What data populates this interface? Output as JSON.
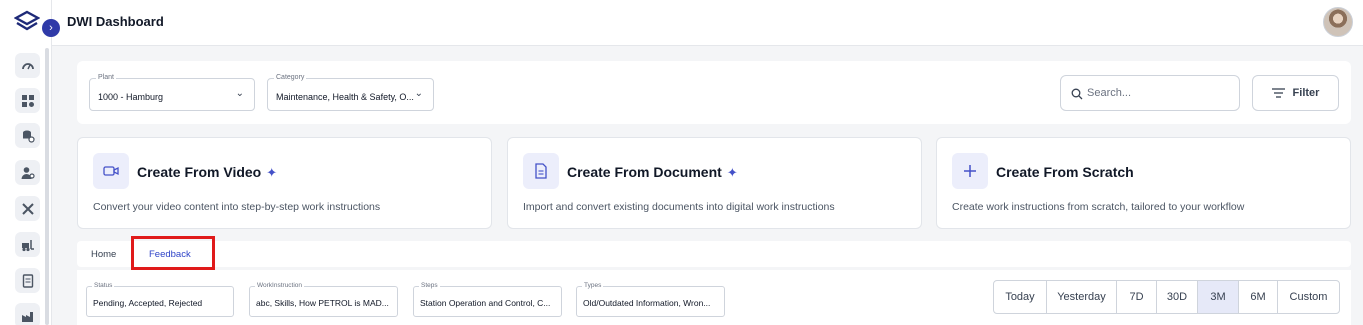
{
  "app": {
    "title": "DWI Dashboard"
  },
  "sidebar": {
    "expand_glyph": "›",
    "items": [
      {
        "icon": "gauge-icon"
      },
      {
        "icon": "apps-grid-icon"
      },
      {
        "icon": "database-settings-icon"
      },
      {
        "icon": "user-settings-icon"
      },
      {
        "icon": "tools-icon"
      },
      {
        "icon": "forklift-icon"
      },
      {
        "icon": "document-icon"
      },
      {
        "icon": "factory-icon"
      }
    ]
  },
  "filters": {
    "plant": {
      "label": "Plant",
      "value": "1000 - Hamburg"
    },
    "category": {
      "label": "Category",
      "value": "Maintenance, Health & Safety, O..."
    },
    "search_placeholder": "Search...",
    "filter_label": "Filter"
  },
  "create_cards": [
    {
      "title": "Create From Video",
      "description": "Convert your video content into step-by-step work instructions",
      "icon": "video-icon",
      "ai": true
    },
    {
      "title": "Create From Document",
      "description": "Import and convert existing documents into digital work instructions",
      "icon": "document-icon",
      "ai": true
    },
    {
      "title": "Create From Scratch",
      "description": "Create work instructions from scratch, tailored to your workflow",
      "icon": "plus-icon",
      "ai": false
    }
  ],
  "sparkle_glyph": "✦",
  "tabs": [
    {
      "label": "Home",
      "active": false
    },
    {
      "label": "Feedback",
      "active": true
    }
  ],
  "feedback_filters": {
    "status": {
      "label": "Status",
      "value": "Pending, Accepted, Rejected"
    },
    "work_instruction": {
      "label": "WorkInstruction",
      "value": "abc, Skills, How PETROL is MAD..."
    },
    "steps": {
      "label": "Steps",
      "value": "Station Operation and Control, C..."
    },
    "types": {
      "label": "Types",
      "value": "Old/Outdated Information, Wron..."
    }
  },
  "date_range": {
    "options": [
      "Today",
      "Yesterday",
      "7D",
      "30D",
      "3M",
      "6M",
      "Custom"
    ],
    "selected": "3M"
  },
  "colors": {
    "accent": "#2f44c8",
    "highlight_box": "#e01a1a",
    "active_range": "#e6e9f8"
  }
}
